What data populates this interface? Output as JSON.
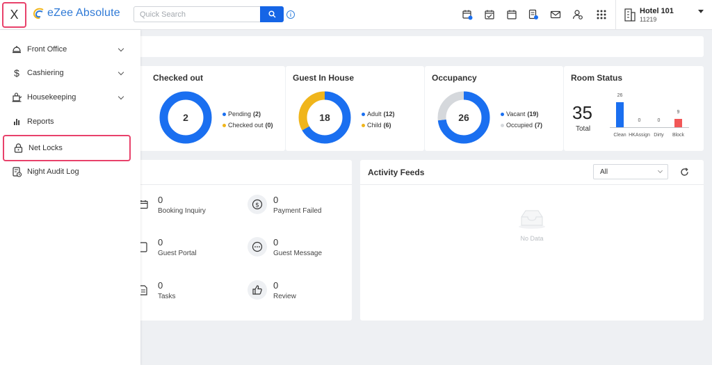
{
  "topbar": {
    "close_label": "X",
    "logo_text": "eZee Absolute",
    "search_placeholder": "Quick Search",
    "hotel_name": "Hotel 101",
    "hotel_code": "11219"
  },
  "sidemenu": {
    "items": [
      {
        "label": "Front Office",
        "icon": "bell-icon"
      },
      {
        "label": "Cashiering",
        "icon": "dollar-icon"
      },
      {
        "label": "Housekeeping",
        "icon": "housekeeping-icon"
      },
      {
        "label": "Reports",
        "icon": "bar-chart-icon"
      },
      {
        "label": "Net Locks",
        "icon": "lock-icon"
      },
      {
        "label": "Night Audit Log",
        "icon": "audit-log-icon"
      }
    ]
  },
  "stats": {
    "checked_out": {
      "title": "Checked out",
      "value": "2",
      "legend": [
        {
          "label": "Pending",
          "count": "(2)",
          "color": "#1a6ff0"
        },
        {
          "label": "Checked out",
          "count": "(0)",
          "color": "#f0b51b"
        }
      ]
    },
    "guest_in_house": {
      "title": "Guest In House",
      "value": "18",
      "legend": [
        {
          "label": "Adult",
          "count": "(12)",
          "color": "#1a6ff0"
        },
        {
          "label": "Child",
          "count": "(6)",
          "color": "#f0b51b"
        }
      ]
    },
    "occupancy": {
      "title": "Occupancy",
      "value": "26",
      "legend": [
        {
          "label": "Vacant",
          "count": "(19)",
          "color": "#1a6ff0"
        },
        {
          "label": "Occupied",
          "count": "(7)",
          "color": "#d5d8dc"
        }
      ]
    },
    "room_status": {
      "title": "Room Status",
      "total_value": "35",
      "total_label": "Total"
    }
  },
  "chart_data": {
    "type": "bar",
    "title": "Room Status",
    "categories": [
      "Clean",
      "HKAssign",
      "Dirty",
      "Block"
    ],
    "values": [
      26,
      0,
      0,
      9
    ],
    "colors": [
      "#1a6ff0",
      "#1a6ff0",
      "#1a6ff0",
      "#f25757"
    ],
    "ylim": [
      0,
      26
    ]
  },
  "notifications": [
    {
      "count": "0",
      "label": "Booking Inquiry",
      "icon": "calendar-icon"
    },
    {
      "count": "0",
      "label": "Payment Failed",
      "icon": "dollar-circle-icon"
    },
    {
      "count": "0",
      "label": "Guest Portal",
      "icon": "tablet-icon"
    },
    {
      "count": "0",
      "label": "Guest Message",
      "icon": "chat-icon"
    },
    {
      "count": "0",
      "label": "Tasks",
      "icon": "document-icon"
    },
    {
      "count": "0",
      "label": "Review",
      "icon": "thumbs-up-icon"
    }
  ],
  "activity": {
    "title": "Activity Feeds",
    "filter_value": "All",
    "empty_text": "No Data"
  }
}
